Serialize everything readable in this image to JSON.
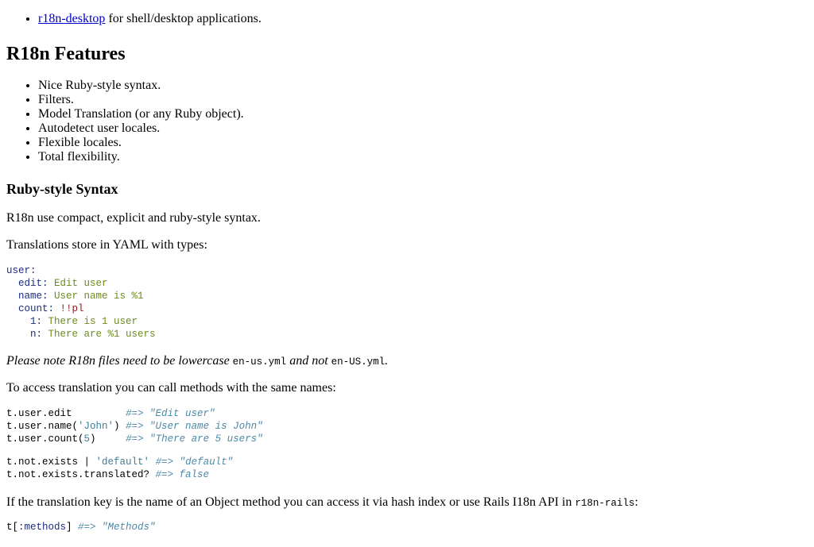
{
  "intro_item": {
    "link": "r18n-desktop",
    "text": " for shell/desktop applications."
  },
  "features": {
    "title": "R18n Features",
    "items": [
      "Nice Ruby-style syntax.",
      "Filters.",
      "Model Translation (or any Ruby object).",
      "Autodetect user locales.",
      "Flexible locales.",
      "Total flexibility."
    ]
  },
  "syntax": {
    "title": "Ruby-style Syntax",
    "p1": "R18n use compact, explicit and ruby-style syntax.",
    "p2": "Translations store in YAML with types:",
    "yaml": {
      "l1_key": "user:",
      "l2_key": "  edit: ",
      "l2_val": "Edit user",
      "l3_key": "  name: ",
      "l3_val": "User name is %1",
      "l4_key": "  count: ",
      "l4_val": "!!pl",
      "l5_key": "    1: ",
      "l5_val": "There is 1 user",
      "l6_key": "    n: ",
      "l6_val": "There are %1 users"
    },
    "note": {
      "a": "Please note R18n files need to be lowercase ",
      "code1": "en-us.yml",
      "b": " and not ",
      "code2": "en-US.yml",
      "c": "."
    },
    "p3": "To access translation you can call methods with the same names:",
    "code1": {
      "r1_a": "t.user.edit         ",
      "r1_c": "#=> \"Edit user\"",
      "r2_a": "t.user.name(",
      "r2_s": "'John'",
      "r2_b": ") ",
      "r2_c": "#=> \"User name is John\"",
      "r3_a": "t.user.count(",
      "r3_n": "5",
      "r3_b": ")     ",
      "r3_c": "#=> \"There are 5 users\""
    },
    "code2": {
      "r1_a": "t.not.exists | ",
      "r1_s": "'default'",
      "r1_b": " ",
      "r1_c": "#=> \"default\"",
      "r2_a": "t.not.exists.translated? ",
      "r2_c": "#=> false"
    },
    "p4": {
      "text": "If the translation key is the name of an Object method you can access it via hash index or use Rails I18n API in ",
      "code": "r18n-rails",
      "end": ":"
    },
    "code3": {
      "a": "t[",
      "sym": ":methods",
      "b": "] ",
      "c": "#=> \"Methods\""
    }
  }
}
